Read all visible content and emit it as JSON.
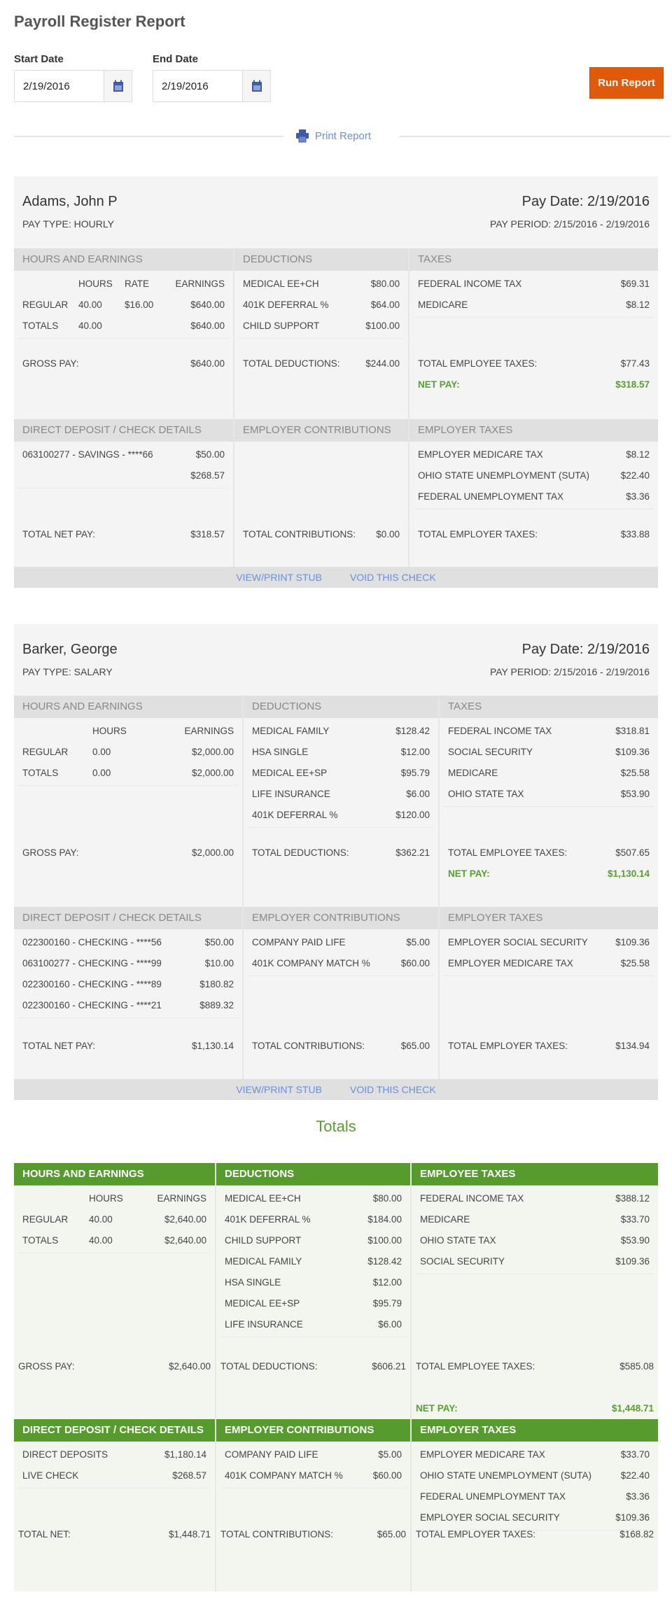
{
  "page": {
    "title": "Payroll Register Report",
    "start_date_label": "Start Date",
    "start_date_value": "2/19/2016",
    "end_date_label": "End Date",
    "end_date_value": "2/19/2016",
    "run_report_label": "Run Report",
    "print_report_label": "Print Report",
    "accent_color": "#e05a0c",
    "link_color": "#6b8fd6",
    "green_color": "#569b2e"
  },
  "employees": [
    {
      "name": "Adams, John P",
      "pay_type": "PAY TYPE: HOURLY",
      "pay_date": "Pay Date: 2/19/2016",
      "pay_period": "PAY PERIOD: 2/15/2016 - 2/19/2016",
      "hours_header": "HOURS AND EARNINGS",
      "hours_columns": [
        "",
        "HOURS",
        "RATE",
        "EARNINGS"
      ],
      "hours_rows": [
        [
          "REGULAR",
          "40.00",
          "$16.00",
          "$640.00"
        ],
        [
          "TOTALS",
          "40.00",
          "",
          "$640.00"
        ]
      ],
      "gross_pay_label": "GROSS PAY:",
      "gross_pay": "$640.00",
      "deductions_header": "DEDUCTIONS",
      "deductions": [
        {
          "label": "MEDICAL EE+CH",
          "value": "$80.00"
        },
        {
          "label": "401K DEFERRAL %",
          "value": "$64.00"
        },
        {
          "label": "CHILD SUPPORT",
          "value": "$100.00"
        }
      ],
      "total_deductions_label": "TOTAL DEDUCTIONS:",
      "total_deductions": "$244.00",
      "taxes_header": "TAXES",
      "taxes": [
        {
          "label": "FEDERAL INCOME TAX",
          "value": "$69.31"
        },
        {
          "label": "MEDICARE",
          "value": "$8.12"
        }
      ],
      "total_employee_taxes_label": "TOTAL EMPLOYEE TAXES:",
      "total_employee_taxes": "$77.43",
      "net_pay_label": "NET PAY:",
      "net_pay": "$318.57",
      "deposit_header": "DIRECT DEPOSIT / CHECK DETAILS",
      "deposits": [
        {
          "label": "063100277 - SAVINGS - ****66",
          "value": "$50.00"
        },
        {
          "label": "",
          "value": "$268.57"
        }
      ],
      "total_net_pay_label": "TOTAL NET PAY:",
      "total_net_pay": "$318.57",
      "contrib_header": "EMPLOYER CONTRIBUTIONS",
      "contributions": [],
      "total_contributions_label": "TOTAL CONTRIBUTIONS:",
      "total_contributions": "$0.00",
      "emp_taxes_header": "EMPLOYER TAXES",
      "employer_taxes": [
        {
          "label": "EMPLOYER MEDICARE TAX",
          "value": "$8.12"
        },
        {
          "label": "OHIO STATE UNEMPLOYMENT (SUTA)",
          "value": "$22.40"
        },
        {
          "label": "FEDERAL UNEMPLOYMENT TAX",
          "value": "$3.36"
        }
      ],
      "total_employer_taxes_label": "TOTAL EMPLOYER TAXES:",
      "total_employer_taxes": "$33.88",
      "view_stub_label": "VIEW/PRINT STUB",
      "void_label": "VOID THIS CHECK"
    },
    {
      "name": "Barker, George",
      "pay_type": "PAY TYPE: SALARY",
      "pay_date": "Pay Date: 2/19/2016",
      "pay_period": "PAY PERIOD: 2/15/2016 - 2/19/2016",
      "hours_header": "HOURS AND EARNINGS",
      "hours_columns": [
        "",
        "HOURS",
        "EARNINGS"
      ],
      "hours_rows": [
        [
          "REGULAR",
          "0.00",
          "$2,000.00"
        ],
        [
          "TOTALS",
          "0.00",
          "$2,000.00"
        ]
      ],
      "gross_pay_label": "GROSS PAY:",
      "gross_pay": "$2,000.00",
      "deductions_header": "DEDUCTIONS",
      "deductions": [
        {
          "label": "MEDICAL FAMILY",
          "value": "$128.42"
        },
        {
          "label": "HSA SINGLE",
          "value": "$12.00"
        },
        {
          "label": "MEDICAL EE+SP",
          "value": "$95.79"
        },
        {
          "label": "LIFE INSURANCE",
          "value": "$6.00"
        },
        {
          "label": "401K DEFERRAL %",
          "value": "$120.00"
        }
      ],
      "total_deductions_label": "TOTAL DEDUCTIONS:",
      "total_deductions": "$362.21",
      "taxes_header": "TAXES",
      "taxes": [
        {
          "label": "FEDERAL INCOME TAX",
          "value": "$318.81"
        },
        {
          "label": "SOCIAL SECURITY",
          "value": "$109.36"
        },
        {
          "label": "MEDICARE",
          "value": "$25.58"
        },
        {
          "label": "OHIO STATE TAX",
          "value": "$53.90"
        }
      ],
      "total_employee_taxes_label": "TOTAL EMPLOYEE TAXES:",
      "total_employee_taxes": "$507.65",
      "net_pay_label": "NET PAY:",
      "net_pay": "$1,130.14",
      "deposit_header": "DIRECT DEPOSIT / CHECK DETAILS",
      "deposits": [
        {
          "label": "022300160 - CHECKING - ****56",
          "value": "$50.00"
        },
        {
          "label": "063100277 - CHECKING - ****99",
          "value": "$10.00"
        },
        {
          "label": "022300160 - CHECKING - ****89",
          "value": "$180.82"
        },
        {
          "label": "022300160 - CHECKING - ****21",
          "value": "$889.32"
        }
      ],
      "total_net_pay_label": "TOTAL NET PAY:",
      "total_net_pay": "$1,130.14",
      "contrib_header": "EMPLOYER CONTRIBUTIONS",
      "contributions": [
        {
          "label": "COMPANY PAID LIFE",
          "value": "$5.00"
        },
        {
          "label": "401K COMPANY MATCH %",
          "value": "$60.00"
        }
      ],
      "total_contributions_label": "TOTAL CONTRIBUTIONS:",
      "total_contributions": "$65.00",
      "emp_taxes_header": "EMPLOYER TAXES",
      "employer_taxes": [
        {
          "label": "EMPLOYER SOCIAL SECURITY",
          "value": "$109.36"
        },
        {
          "label": "EMPLOYER MEDICARE TAX",
          "value": "$25.58"
        }
      ],
      "total_employer_taxes_label": "TOTAL EMPLOYER TAXES:",
      "total_employer_taxes": "$134.94",
      "view_stub_label": "VIEW/PRINT STUB",
      "void_label": "VOID THIS CHECK"
    }
  ],
  "totals": {
    "title": "Totals",
    "hours_header": "HOURS AND EARNINGS",
    "hours_columns": [
      "",
      "HOURS",
      "EARNINGS"
    ],
    "hours_rows": [
      [
        "REGULAR",
        "40.00",
        "$2,640.00"
      ],
      [
        "TOTALS",
        "40.00",
        "$2,640.00"
      ]
    ],
    "gross_pay_label": "GROSS PAY:",
    "gross_pay": "$2,640.00",
    "deductions_header": "DEDUCTIONS",
    "deductions": [
      {
        "label": "MEDICAL EE+CH",
        "value": "$80.00"
      },
      {
        "label": "401K DEFERRAL %",
        "value": "$184.00"
      },
      {
        "label": "CHILD SUPPORT",
        "value": "$100.00"
      },
      {
        "label": "MEDICAL FAMILY",
        "value": "$128.42"
      },
      {
        "label": "HSA SINGLE",
        "value": "$12.00"
      },
      {
        "label": "MEDICAL EE+SP",
        "value": "$95.79"
      },
      {
        "label": "LIFE INSURANCE",
        "value": "$6.00"
      }
    ],
    "total_deductions_label": "TOTAL DEDUCTIONS:",
    "total_deductions": "$606.21",
    "taxes_header": "EMPLOYEE TAXES",
    "taxes": [
      {
        "label": "FEDERAL INCOME TAX",
        "value": "$388.12"
      },
      {
        "label": "MEDICARE",
        "value": "$33.70"
      },
      {
        "label": "OHIO STATE TAX",
        "value": "$53.90"
      },
      {
        "label": "SOCIAL SECURITY",
        "value": "$109.36"
      }
    ],
    "total_employee_taxes_label": "TOTAL EMPLOYEE TAXES:",
    "total_employee_taxes": "$585.08",
    "net_pay_label": "NET PAY:",
    "net_pay": "$1,448.71",
    "deposit_header": "DIRECT DEPOSIT / CHECK DETAILS",
    "deposits": [
      {
        "label": "DIRECT DEPOSITS",
        "value": "$1,180.14"
      },
      {
        "label": "LIVE CHECK",
        "value": "$268.57"
      }
    ],
    "total_net_label": "TOTAL NET:",
    "total_net": "$1,448.71",
    "contrib_header": "EMPLOYER CONTRIBUTIONS",
    "contributions": [
      {
        "label": "COMPANY PAID LIFE",
        "value": "$5.00"
      },
      {
        "label": "401K COMPANY MATCH %",
        "value": "$60.00"
      }
    ],
    "total_contributions_label": "TOTAL CONTRIBUTIONS:",
    "total_contributions": "$65.00",
    "emp_taxes_header": "EMPLOYER TAXES",
    "employer_taxes": [
      {
        "label": "EMPLOYER MEDICARE TAX",
        "value": "$33.70"
      },
      {
        "label": "OHIO STATE UNEMPLOYMENT (SUTA)",
        "value": "$22.40"
      },
      {
        "label": "FEDERAL UNEMPLOYMENT TAX",
        "value": "$3.36"
      },
      {
        "label": "EMPLOYER SOCIAL SECURITY",
        "value": "$109.36"
      }
    ],
    "total_employer_taxes_label": "TOTAL EMPLOYER TAXES:",
    "total_employer_taxes": "$168.82"
  }
}
